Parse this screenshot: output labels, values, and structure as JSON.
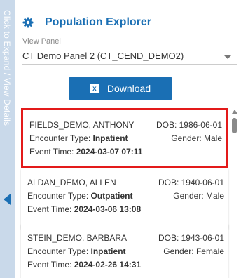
{
  "side_tab": {
    "label": "Click to Expand / View Details"
  },
  "header": {
    "title": "Population Explorer",
    "icon": "gear-icon"
  },
  "view_panel": {
    "label": "View Panel",
    "selected": "CT Demo Panel 2 (CT_CEND_DEMO2)"
  },
  "download": {
    "label": "Download",
    "icon": "excel-icon"
  },
  "colors": {
    "accent": "#1a6fb4",
    "selection_border": "#e31a1a",
    "side_tab_bg": "#c9d9ea"
  },
  "patients": [
    {
      "name": "FIELDS_DEMO, ANTHONY",
      "dob": "DOB: 1986-06-01",
      "encounter_label": "Encounter Type: ",
      "encounter_value": "Inpatient",
      "gender": "Gender: Male",
      "time_label": "Event Time: ",
      "time_value": "2024-03-07 07:11",
      "selected": true
    },
    {
      "name": "ALDAN_DEMO, ALLEN",
      "dob": "DOB: 1940-06-01",
      "encounter_label": "Encounter Type: ",
      "encounter_value": "Outpatient",
      "gender": "Gender: Male",
      "time_label": "Event Time: ",
      "time_value": "2024-03-06 13:08",
      "selected": false
    },
    {
      "name": "STEIN_DEMO, BARBARA",
      "dob": "DOB: 1943-06-01",
      "encounter_label": "Encounter Type: ",
      "encounter_value": "Inpatient",
      "gender": "Gender: Female",
      "time_label": "Event Time: ",
      "time_value": "2024-02-26 14:31",
      "selected": false
    }
  ]
}
